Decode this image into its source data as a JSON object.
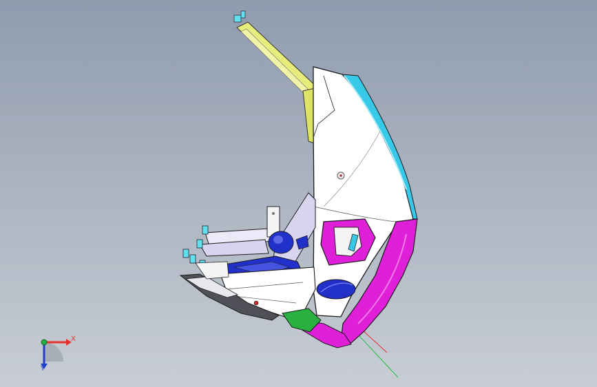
{
  "triad": {
    "x_label": "X",
    "y_label": "Y",
    "x_color": "#e8302a",
    "y_color": "#2040c8",
    "origin_color": "#20b040"
  },
  "model": {
    "palette": {
      "body": "#ffffff",
      "outline": "#1a1a1a",
      "edge_cyan": "#38c8e8",
      "edge_magenta": "#e020d8",
      "arm_yellow": "#e8ec7a",
      "accent_blue": "#2030c8",
      "lavender": "#d8d4f0",
      "green": "#28b040",
      "tab_cyan": "#60e0f0",
      "dark_part": "#505058"
    }
  },
  "reference_axes": {
    "red_color": "#e03030",
    "green_color": "#20c040"
  }
}
